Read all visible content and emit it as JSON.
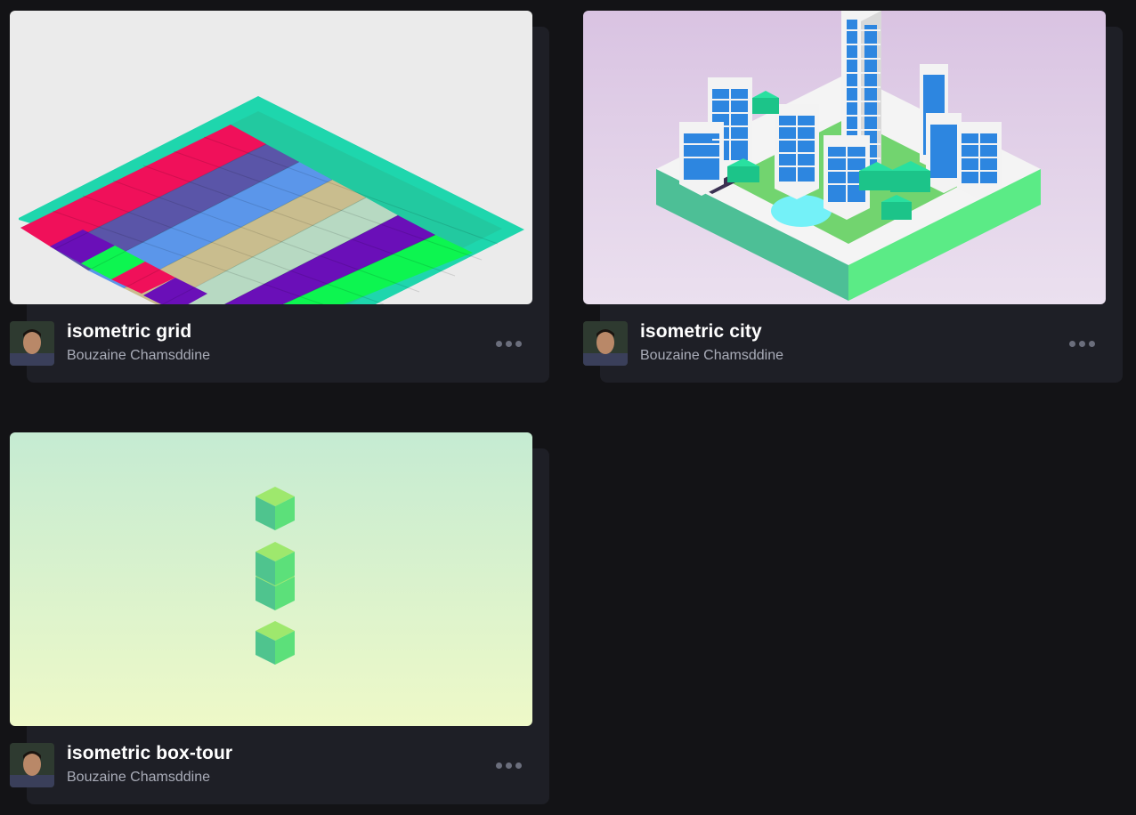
{
  "cards": [
    {
      "title": "isometric grid",
      "author": "Bouzaine Chamsddine",
      "thumbnail_icon": "isometric-grid-preview",
      "more_icon": "more-dots-icon"
    },
    {
      "title": "isometric city",
      "author": "Bouzaine Chamsddine",
      "thumbnail_icon": "isometric-city-preview",
      "more_icon": "more-dots-icon"
    },
    {
      "title": "isometric box-tour",
      "author": "Bouzaine Chamsddine",
      "thumbnail_icon": "isometric-box-tour-preview",
      "more_icon": "more-dots-icon"
    }
  ],
  "colors": {
    "background": "#131316",
    "card_panel": "#1e1f26",
    "title": "#ffffff",
    "author": "#a9acb8",
    "more_dots": "#6b6e7c"
  }
}
